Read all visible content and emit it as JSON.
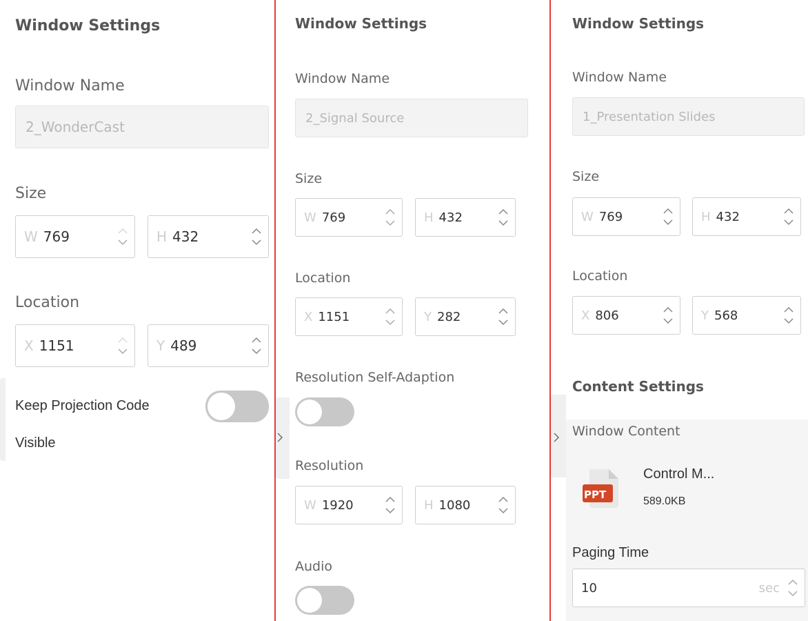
{
  "panel1": {
    "title": "Window Settings",
    "window_name_label": "Window Name",
    "window_name_value": "2_WonderCast",
    "size_label": "Size",
    "w_prefix": "W",
    "w_value": "769",
    "h_prefix": "H",
    "h_value": "432",
    "location_label": "Location",
    "x_prefix": "X",
    "x_value": "1151",
    "y_prefix": "Y",
    "y_value": "489",
    "keep_code_label_line1": "Keep Projection Code",
    "keep_code_label_line2": "Visible",
    "keep_code_toggle_on": false
  },
  "panel2": {
    "title": "Window Settings",
    "window_name_label": "Window Name",
    "window_name_value": "2_Signal Source",
    "size_label": "Size",
    "w_prefix": "W",
    "w_value": "769",
    "h_prefix": "H",
    "h_value": "432",
    "location_label": "Location",
    "x_prefix": "X",
    "x_value": "1151",
    "y_prefix": "Y",
    "y_value": "282",
    "resolution_adapt_label": "Resolution Self-Adaption",
    "resolution_adapt_toggle_on": false,
    "resolution_label": "Resolution",
    "rw_prefix": "W",
    "rw_value": "1920",
    "rh_prefix": "H",
    "rh_value": "1080",
    "audio_label": "Audio",
    "audio_toggle_on": false
  },
  "panel3": {
    "title": "Window Settings",
    "window_name_label": "Window Name",
    "window_name_value": "1_Presentation Slides",
    "size_label": "Size",
    "w_prefix": "W",
    "w_value": "769",
    "h_prefix": "H",
    "h_value": "432",
    "location_label": "Location",
    "x_prefix": "X",
    "x_value": "806",
    "y_prefix": "Y",
    "y_value": "568",
    "content_settings_title": "Content Settings",
    "window_content_label": "Window Content",
    "file_icon_text": "PPT",
    "file_name": "Control M...",
    "file_size": "589.0KB",
    "paging_time_label": "Paging Time",
    "paging_time_value": "10",
    "paging_time_unit": "sec"
  },
  "colors": {
    "divider": "#e23b3b",
    "ppt_icon": "#d24726",
    "toggle_off": "#c8c8c8"
  }
}
